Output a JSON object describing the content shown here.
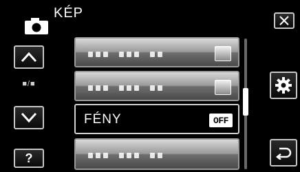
{
  "header": {
    "title": "KÉP",
    "icon": "camera-icon"
  },
  "sidebar": {
    "up_icon": "chevron-up-icon",
    "page_indicator": "■/■",
    "down_icon": "chevron-down-icon",
    "help_label": "?"
  },
  "menu": {
    "rows": [
      {
        "label": "",
        "value": "",
        "selected": false
      },
      {
        "label": "",
        "value": "",
        "selected": false
      },
      {
        "label": "FÉNY",
        "value": "OFF",
        "selected": true
      },
      {
        "label": "",
        "value": "",
        "selected": false
      }
    ]
  },
  "right": {
    "close_icon": "close-icon",
    "settings_icon": "gear-icon",
    "back_icon": "return-icon"
  }
}
